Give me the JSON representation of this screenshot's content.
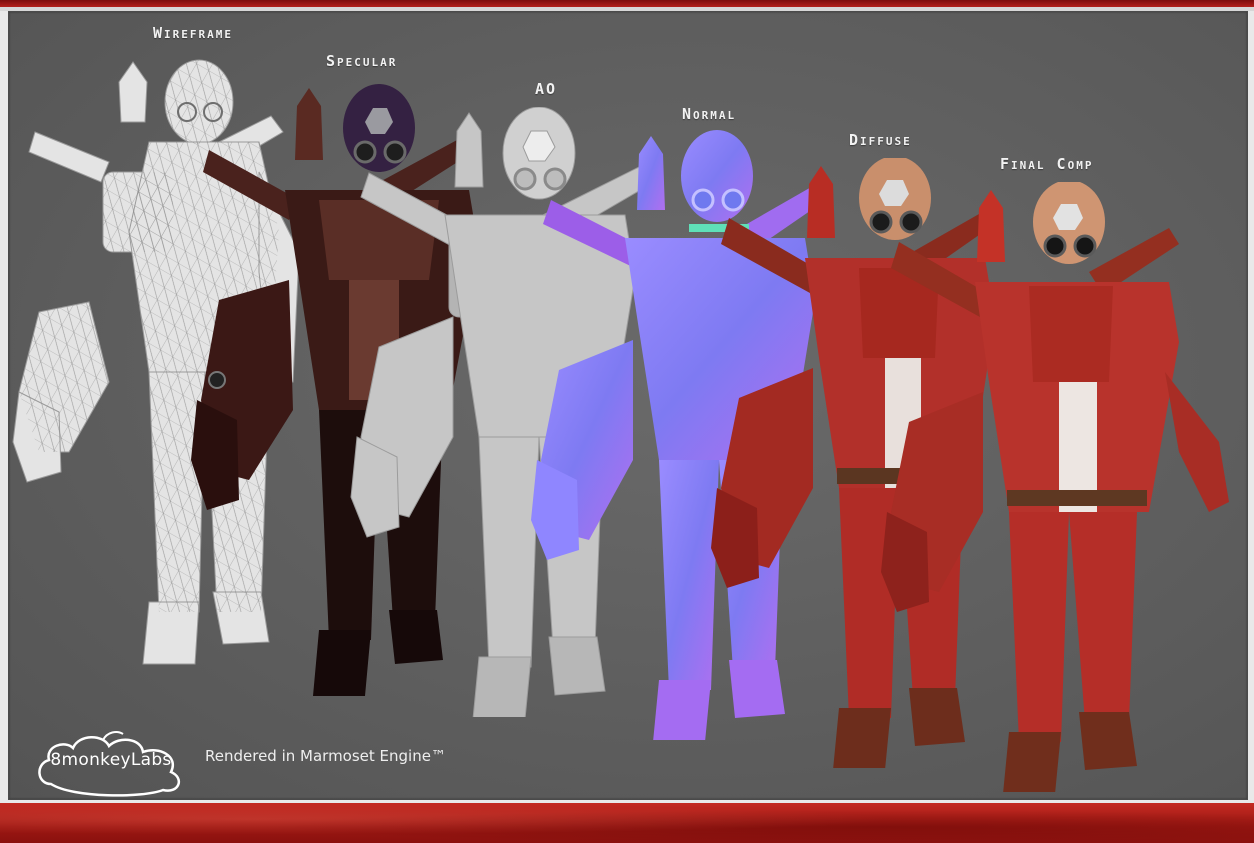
{
  "passes": [
    {
      "label": "Wireframe"
    },
    {
      "label": "Specular"
    },
    {
      "label": "AO"
    },
    {
      "label": "Normal"
    },
    {
      "label": "Diffuse"
    },
    {
      "label": "Final Comp"
    }
  ],
  "logo": {
    "text": "8monkeyLabs"
  },
  "render_note": "Rendered in Marmoset Engine™",
  "colors": {
    "wireframe": "#e6e6e6",
    "specular": "#3a1a17",
    "ao": "#c8c8c8",
    "normal": "#8a7cf0",
    "diffuse": "#b2302a",
    "final": "#b8332c",
    "background": "#5f5f5f",
    "frame_red": "#a81b16"
  }
}
